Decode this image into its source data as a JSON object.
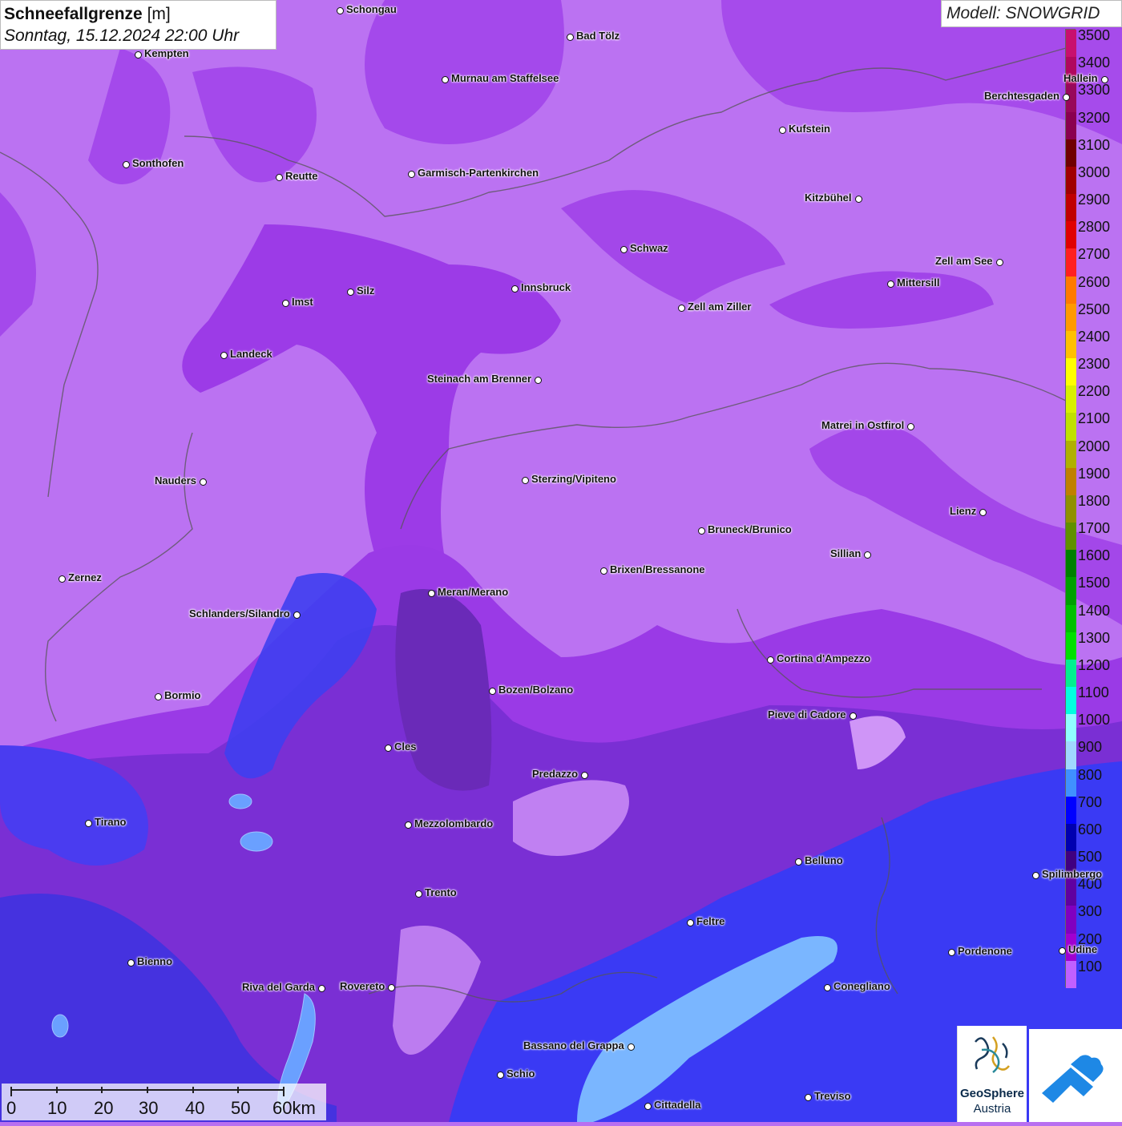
{
  "title": {
    "main": "Schneefallgrenze",
    "unit": "[m]",
    "datetime": "Sonntag, 15.12.2024 22:00 Uhr"
  },
  "model": "Modell: SNOWGRID",
  "legend": {
    "labels": [
      "3500",
      "3400",
      "3300",
      "3200",
      "3100",
      "3000",
      "2900",
      "2800",
      "2700",
      "2600",
      "2500",
      "2400",
      "2300",
      "2200",
      "2100",
      "2000",
      "1900",
      "1800",
      "1700",
      "1600",
      "1500",
      "1400",
      "1300",
      "1200",
      "1100",
      "1000",
      "900",
      "800",
      "700",
      "600",
      "500",
      "400",
      "300",
      "200",
      "100"
    ],
    "colors": [
      "#c8106e",
      "#b0085e",
      "#98085a",
      "#8a0050",
      "#700000",
      "#a00000",
      "#c00000",
      "#e00000",
      "#ff2020",
      "#ff7a00",
      "#ff9a00",
      "#ffc000",
      "#ffff00",
      "#d8f000",
      "#c0e000",
      "#b0b000",
      "#c08000",
      "#909000",
      "#609000",
      "#008000",
      "#00a000",
      "#00c000",
      "#00e000",
      "#00f090",
      "#00ffe0",
      "#90ffff",
      "#a0d8ff",
      "#4090ff",
      "#0000ff",
      "#0000b0",
      "#400080",
      "#6000a0",
      "#8000c0",
      "#a000d0",
      "#c060ff"
    ]
  },
  "cities": [
    {
      "name": "Schongau",
      "side": "r"
    },
    {
      "name": "Bad Tölz",
      "side": "r"
    },
    {
      "name": "Kempten",
      "side": "r"
    },
    {
      "name": "Murnau am Staffelsee",
      "side": "r"
    },
    {
      "name": "Berchtesgaden",
      "side": "l"
    },
    {
      "name": "Kufstein",
      "side": "r"
    },
    {
      "name": "Sonthofen",
      "side": "r"
    },
    {
      "name": "Reutte",
      "side": "r"
    },
    {
      "name": "Garmisch-Partenkirchen",
      "side": "r"
    },
    {
      "name": "Kitzbühel",
      "side": "l"
    },
    {
      "name": "Schwaz",
      "side": "r"
    },
    {
      "name": "Zell am See",
      "side": "l"
    },
    {
      "name": "Mittersill",
      "side": "r"
    },
    {
      "name": "Innsbruck",
      "side": "r"
    },
    {
      "name": "Silz",
      "side": "r"
    },
    {
      "name": "Imst",
      "side": "r"
    },
    {
      "name": "Zell am Ziller",
      "side": "r"
    },
    {
      "name": "Landeck",
      "side": "r"
    },
    {
      "name": "Steinach am Brenner",
      "side": "l"
    },
    {
      "name": "Matrei in Ostfirol",
      "side": "l"
    },
    {
      "name": "Nauders",
      "side": "l"
    },
    {
      "name": "Sterzing/Vipiteno",
      "side": "r"
    },
    {
      "name": "Lienz",
      "side": "l"
    },
    {
      "name": "Bruneck/Brunico",
      "side": "r"
    },
    {
      "name": "Sillian",
      "side": "l"
    },
    {
      "name": "Zernez",
      "side": "r"
    },
    {
      "name": "Brixen/Bressanone",
      "side": "r"
    },
    {
      "name": "Meran/Merano",
      "side": "r"
    },
    {
      "name": "Schlanders/Silandro",
      "side": "l"
    },
    {
      "name": "Cortina d'Ampezzo",
      "side": "r"
    },
    {
      "name": "Bozen/Bolzano",
      "side": "r"
    },
    {
      "name": "Bormio",
      "side": "r"
    },
    {
      "name": "Pieve di Cadore",
      "side": "l"
    },
    {
      "name": "Cles",
      "side": "r"
    },
    {
      "name": "Predazzo",
      "side": "l"
    },
    {
      "name": "Tirano",
      "side": "r"
    },
    {
      "name": "Mezzolombardo",
      "side": "r"
    },
    {
      "name": "Belluno",
      "side": "r"
    },
    {
      "name": "Spilimbergo",
      "side": "r"
    },
    {
      "name": "Trento",
      "side": "r"
    },
    {
      "name": "Feltre",
      "side": "r"
    },
    {
      "name": "Pordenone",
      "side": "r"
    },
    {
      "name": "Bienno",
      "side": "r"
    },
    {
      "name": "Riva del Garda",
      "side": "l"
    },
    {
      "name": "Rovereto",
      "side": "l"
    },
    {
      "name": "Conegliano",
      "side": "r"
    },
    {
      "name": "Bassano del Grappa",
      "side": "l"
    },
    {
      "name": "Schio",
      "side": "r"
    },
    {
      "name": "Treviso",
      "side": "r"
    },
    {
      "name": "Cittadella",
      "side": "r"
    },
    {
      "name": "Hallein",
      "side": "l"
    },
    {
      "name": "Udine",
      "side": "r"
    }
  ],
  "scale": {
    "ticks": [
      "0",
      "10",
      "20",
      "30",
      "40",
      "50",
      "60km"
    ]
  },
  "logos": {
    "geosphere_line1": "GeoSphere",
    "geosphere_line2": "Austria"
  }
}
